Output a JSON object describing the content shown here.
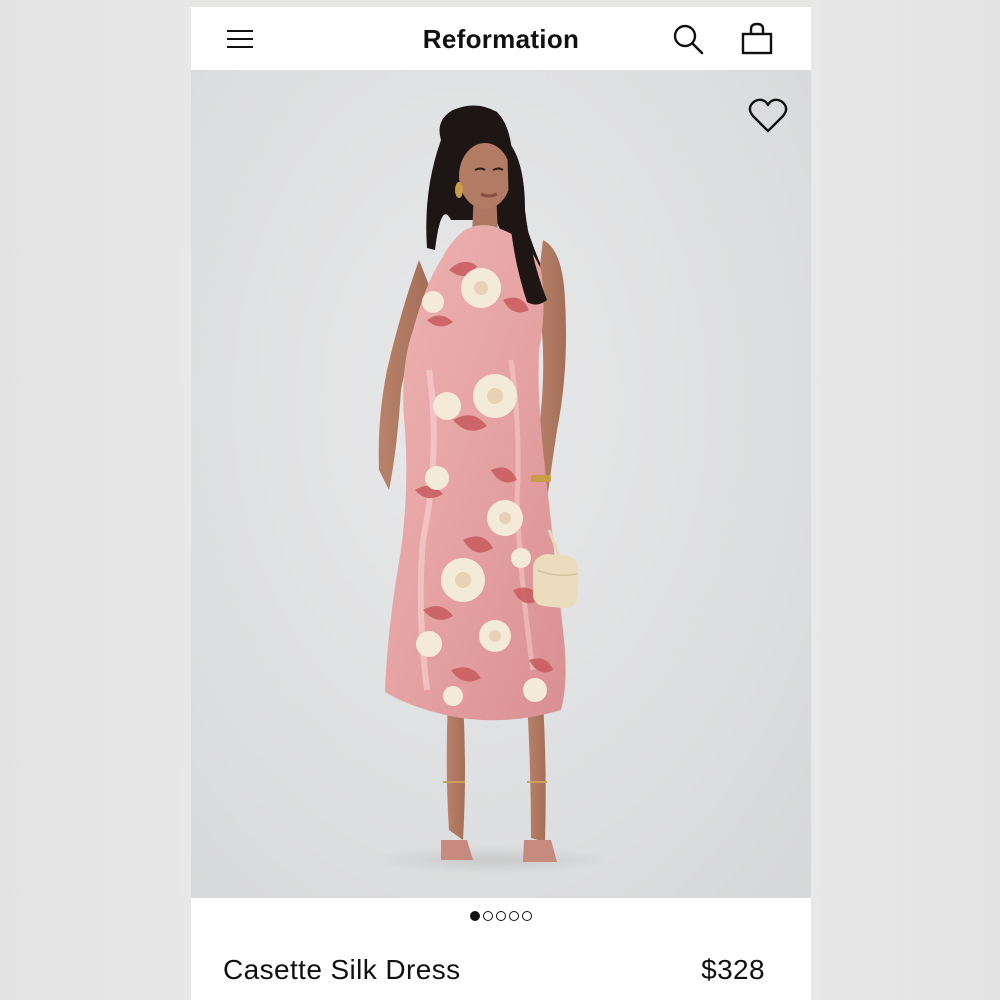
{
  "header": {
    "brand": "Reformation",
    "icons": {
      "menu": "hamburger-menu-icon",
      "search": "search-icon",
      "bag": "shopping-bag-icon"
    }
  },
  "gallery": {
    "wishlist_icon": "heart-outline-icon",
    "image_count": 5,
    "active_index": 0
  },
  "product": {
    "title": "Casette Silk Dress",
    "price": "$328"
  },
  "colors": {
    "text": "#111111",
    "background": "#ffffff",
    "photo_backdrop": "#dedfe0",
    "dress_pink": "#e8a8a8",
    "dress_rose": "#c95a5e",
    "flower_cream": "#f4ead8"
  }
}
